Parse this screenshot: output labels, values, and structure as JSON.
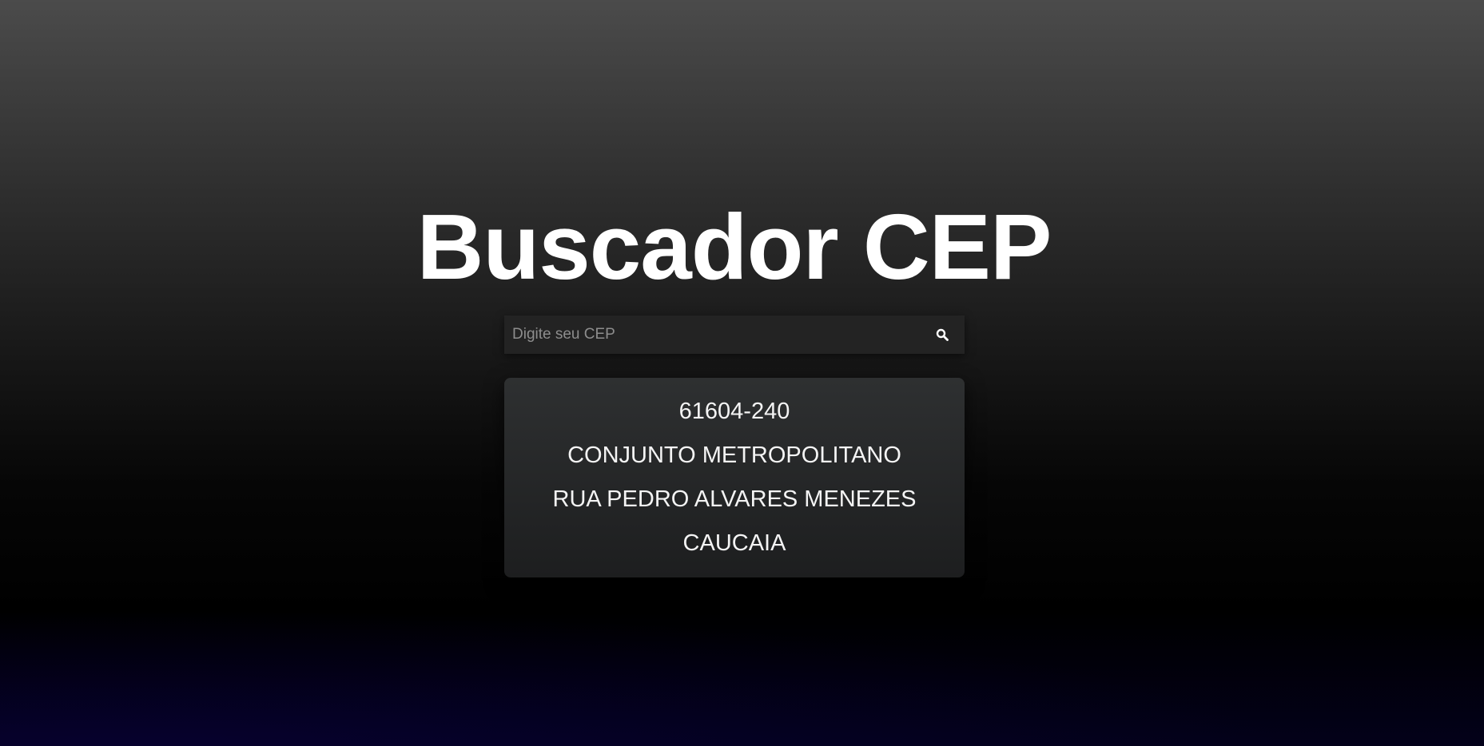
{
  "header": {
    "title": "Buscador CEP"
  },
  "search": {
    "placeholder": "Digite seu CEP",
    "value": "",
    "button_icon": "search-icon"
  },
  "result": {
    "cep": "61604-240",
    "bairro": "CONJUNTO METROPOLITANO",
    "logradouro": "RUA PEDRO ALVARES MENEZES",
    "cidade": "CAUCAIA"
  },
  "colors": {
    "background_top": "#4b4b4b",
    "background_bottom": "#000000",
    "card": "#2a2c2d",
    "text": "#ffffff"
  }
}
